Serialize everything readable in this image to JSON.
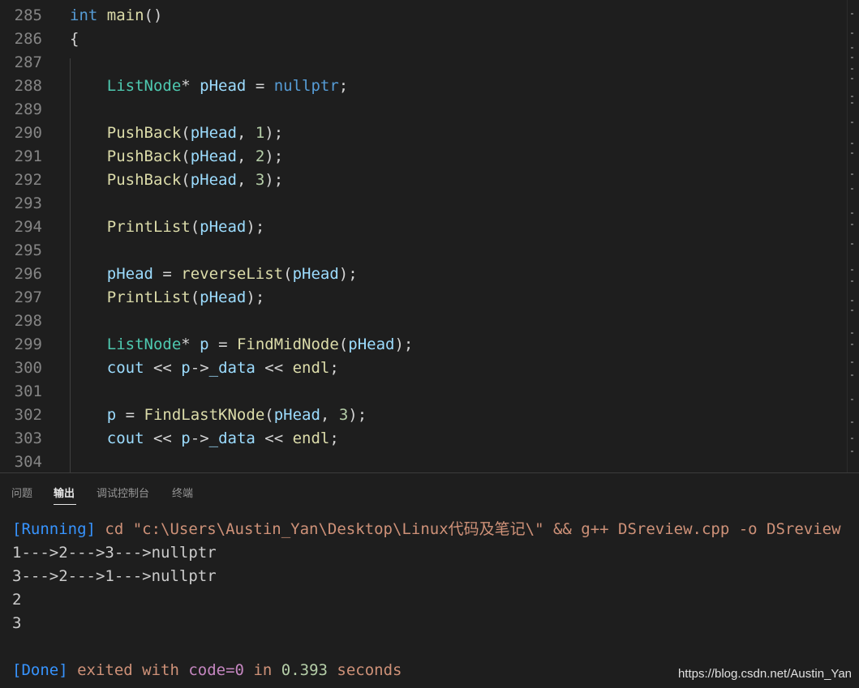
{
  "editor": {
    "lines": [
      {
        "num": "285",
        "tokens": [
          {
            "t": "int",
            "c": "kw"
          },
          {
            "t": " ",
            "c": "txt"
          },
          {
            "t": "main",
            "c": "fn"
          },
          {
            "t": "()",
            "c": "txt"
          }
        ]
      },
      {
        "num": "286",
        "tokens": [
          {
            "t": "{",
            "c": "txt"
          }
        ]
      },
      {
        "num": "287",
        "tokens": []
      },
      {
        "num": "288",
        "tokens": [
          {
            "t": "    ",
            "c": "txt"
          },
          {
            "t": "ListNode",
            "c": "ty"
          },
          {
            "t": "* ",
            "c": "txt"
          },
          {
            "t": "pHead",
            "c": "var"
          },
          {
            "t": " = ",
            "c": "txt"
          },
          {
            "t": "nullptr",
            "c": "kw"
          },
          {
            "t": ";",
            "c": "txt"
          }
        ]
      },
      {
        "num": "289",
        "tokens": []
      },
      {
        "num": "290",
        "tokens": [
          {
            "t": "    ",
            "c": "txt"
          },
          {
            "t": "PushBack",
            "c": "fn"
          },
          {
            "t": "(",
            "c": "txt"
          },
          {
            "t": "pHead",
            "c": "var"
          },
          {
            "t": ", ",
            "c": "txt"
          },
          {
            "t": "1",
            "c": "num"
          },
          {
            "t": ");",
            "c": "txt"
          }
        ]
      },
      {
        "num": "291",
        "tokens": [
          {
            "t": "    ",
            "c": "txt"
          },
          {
            "t": "PushBack",
            "c": "fn"
          },
          {
            "t": "(",
            "c": "txt"
          },
          {
            "t": "pHead",
            "c": "var"
          },
          {
            "t": ", ",
            "c": "txt"
          },
          {
            "t": "2",
            "c": "num"
          },
          {
            "t": ");",
            "c": "txt"
          }
        ]
      },
      {
        "num": "292",
        "tokens": [
          {
            "t": "    ",
            "c": "txt"
          },
          {
            "t": "PushBack",
            "c": "fn"
          },
          {
            "t": "(",
            "c": "txt"
          },
          {
            "t": "pHead",
            "c": "var"
          },
          {
            "t": ", ",
            "c": "txt"
          },
          {
            "t": "3",
            "c": "num"
          },
          {
            "t": ");",
            "c": "txt"
          }
        ]
      },
      {
        "num": "293",
        "tokens": []
      },
      {
        "num": "294",
        "tokens": [
          {
            "t": "    ",
            "c": "txt"
          },
          {
            "t": "PrintList",
            "c": "fn"
          },
          {
            "t": "(",
            "c": "txt"
          },
          {
            "t": "pHead",
            "c": "var"
          },
          {
            "t": ");",
            "c": "txt"
          }
        ]
      },
      {
        "num": "295",
        "tokens": []
      },
      {
        "num": "296",
        "tokens": [
          {
            "t": "    ",
            "c": "txt"
          },
          {
            "t": "pHead",
            "c": "var"
          },
          {
            "t": " = ",
            "c": "txt"
          },
          {
            "t": "reverseList",
            "c": "fn"
          },
          {
            "t": "(",
            "c": "txt"
          },
          {
            "t": "pHead",
            "c": "var"
          },
          {
            "t": ");",
            "c": "txt"
          }
        ]
      },
      {
        "num": "297",
        "tokens": [
          {
            "t": "    ",
            "c": "txt"
          },
          {
            "t": "PrintList",
            "c": "fn"
          },
          {
            "t": "(",
            "c": "txt"
          },
          {
            "t": "pHead",
            "c": "var"
          },
          {
            "t": ");",
            "c": "txt"
          }
        ]
      },
      {
        "num": "298",
        "tokens": []
      },
      {
        "num": "299",
        "tokens": [
          {
            "t": "    ",
            "c": "txt"
          },
          {
            "t": "ListNode",
            "c": "ty"
          },
          {
            "t": "* ",
            "c": "txt"
          },
          {
            "t": "p",
            "c": "var"
          },
          {
            "t": " = ",
            "c": "txt"
          },
          {
            "t": "FindMidNode",
            "c": "fn"
          },
          {
            "t": "(",
            "c": "txt"
          },
          {
            "t": "pHead",
            "c": "var"
          },
          {
            "t": ");",
            "c": "txt"
          }
        ]
      },
      {
        "num": "300",
        "tokens": [
          {
            "t": "    ",
            "c": "txt"
          },
          {
            "t": "cout",
            "c": "var"
          },
          {
            "t": " << ",
            "c": "txt"
          },
          {
            "t": "p",
            "c": "var"
          },
          {
            "t": "->",
            "c": "txt"
          },
          {
            "t": "_data",
            "c": "var"
          },
          {
            "t": " << ",
            "c": "txt"
          },
          {
            "t": "endl",
            "c": "fn"
          },
          {
            "t": ";",
            "c": "txt"
          }
        ]
      },
      {
        "num": "301",
        "tokens": []
      },
      {
        "num": "302",
        "tokens": [
          {
            "t": "    ",
            "c": "txt"
          },
          {
            "t": "p",
            "c": "var"
          },
          {
            "t": " = ",
            "c": "txt"
          },
          {
            "t": "FindLastKNode",
            "c": "fn"
          },
          {
            "t": "(",
            "c": "txt"
          },
          {
            "t": "pHead",
            "c": "var"
          },
          {
            "t": ", ",
            "c": "txt"
          },
          {
            "t": "3",
            "c": "num"
          },
          {
            "t": ");",
            "c": "txt"
          }
        ]
      },
      {
        "num": "303",
        "tokens": [
          {
            "t": "    ",
            "c": "txt"
          },
          {
            "t": "cout",
            "c": "var"
          },
          {
            "t": " << ",
            "c": "txt"
          },
          {
            "t": "p",
            "c": "var"
          },
          {
            "t": "->",
            "c": "txt"
          },
          {
            "t": "_data",
            "c": "var"
          },
          {
            "t": " << ",
            "c": "txt"
          },
          {
            "t": "endl",
            "c": "fn"
          },
          {
            "t": ";",
            "c": "txt"
          }
        ]
      },
      {
        "num": "304",
        "tokens": []
      }
    ]
  },
  "panel": {
    "tabs": [
      {
        "label": "问题",
        "active": false
      },
      {
        "label": "输出",
        "active": true
      },
      {
        "label": "调试控制台",
        "active": false
      },
      {
        "label": "终端",
        "active": false
      }
    ],
    "output": [
      [
        {
          "t": "[Running]",
          "c": "tag"
        },
        {
          "t": " cd \"c:\\Users\\Austin_Yan\\Desktop\\Linux代码及笔记\\\" && g++ DSreview.cpp -o DSreview",
          "c": "cmd"
        }
      ],
      [
        {
          "t": "1--->2--->3--->nullptr",
          "c": "plain"
        }
      ],
      [
        {
          "t": "3--->2--->1--->nullptr",
          "c": "plain"
        }
      ],
      [
        {
          "t": "2",
          "c": "plain"
        }
      ],
      [
        {
          "t": "3",
          "c": "plain"
        }
      ],
      [],
      [
        {
          "t": "[Done]",
          "c": "tag"
        },
        {
          "t": " exited with ",
          "c": "cmd"
        },
        {
          "t": "code=0",
          "c": "hl"
        },
        {
          "t": " in ",
          "c": "cmd"
        },
        {
          "t": "0.393",
          "c": "num"
        },
        {
          "t": " seconds",
          "c": "cmd"
        }
      ]
    ]
  },
  "watermark": "https://blog.csdn.net/Austin_Yan"
}
